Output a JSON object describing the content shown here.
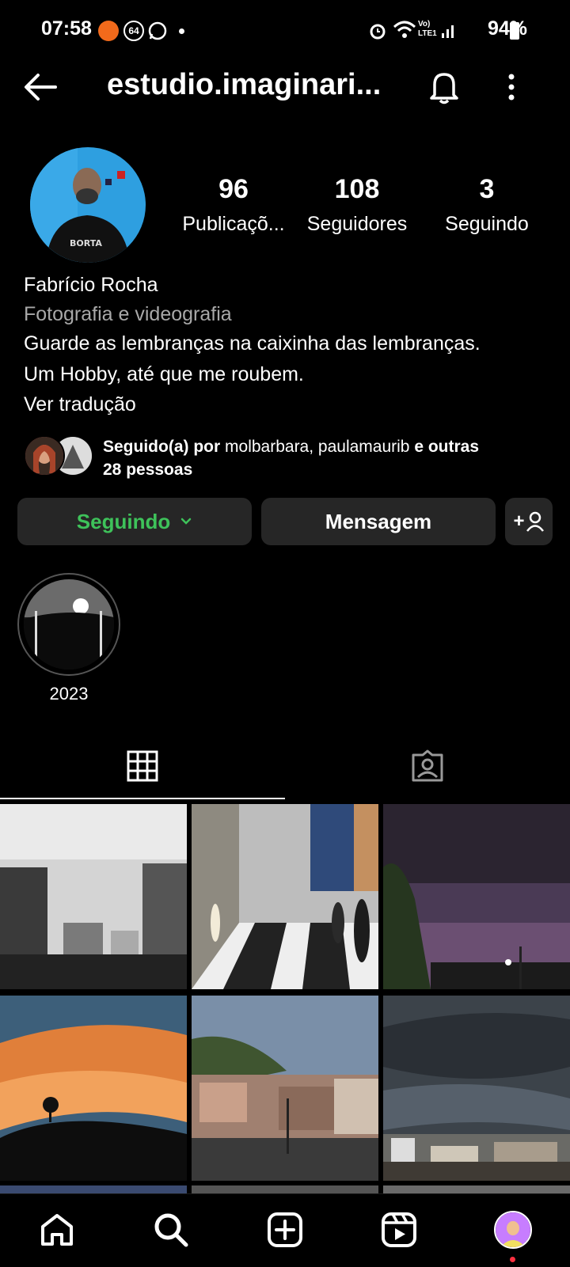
{
  "status_bar": {
    "time": "07:58",
    "badge": "64",
    "battery": "94%",
    "network": "Vo) LTE1"
  },
  "header": {
    "username": "estudio.imaginari..."
  },
  "profile": {
    "stats": [
      {
        "value": "96",
        "label": "Publicaçõ..."
      },
      {
        "value": "108",
        "label": "Seguidores"
      },
      {
        "value": "3",
        "label": "Seguindo"
      }
    ],
    "name": "Fabrício Rocha",
    "category": "Fotografia e videografia",
    "bio_line1": "Guarde as lembranças na caixinha das lembranças.",
    "bio_line2": "Um Hobby, até que me roubem.",
    "translate": "Ver tradução",
    "followed_by": {
      "prefix": "Seguido(a) por",
      "names": "molbarbara, paulamaurib",
      "suffix": "e outras",
      "line2": "28 pessoas"
    }
  },
  "actions": {
    "following_label": "Seguindo",
    "message_label": "Mensagem",
    "add_user_label": "+"
  },
  "highlights": [
    {
      "label": "2023"
    }
  ],
  "colors": {
    "following_green": "#3ec25a",
    "button_bg": "#262626",
    "muted_text": "#a8a8a8"
  }
}
